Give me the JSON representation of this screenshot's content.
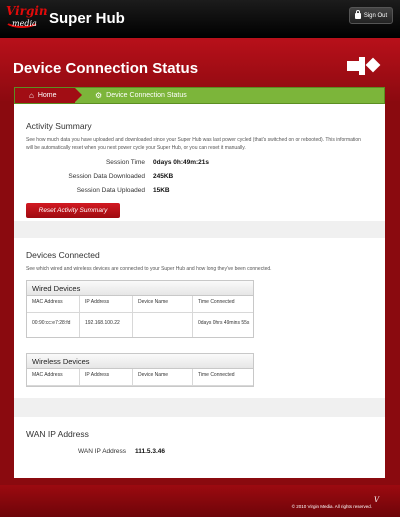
{
  "app": {
    "logo_text": "Virgin media",
    "title": "Super Hub",
    "sign_out": "Sign Out"
  },
  "page": {
    "title": "Device Connection Status"
  },
  "breadcrumb": {
    "home": "Home",
    "current": "Device Connection Status"
  },
  "activity": {
    "title": "Activity Summary",
    "description": "See how much data you have uploaded and downloaded since your Super Hub was last power cycled (that's switched on or rebooted). This information will be automatically reset when you next power cycle your Super Hub, or you can reset it manually.",
    "rows": [
      {
        "label": "Session Time",
        "value": "0days 0h:49m:21s"
      },
      {
        "label": "Session Data Downloaded",
        "value": "245KB"
      },
      {
        "label": "Session Data Uploaded",
        "value": "15KB"
      }
    ],
    "reset_button": "Reset Activity Summary"
  },
  "devices": {
    "title": "Devices Connected",
    "description": "See which wired and wireless devices are connected to your Super Hub and how long they've been connected.",
    "columns": [
      "MAC Address",
      "IP Address",
      "Device Name",
      "Time Connected"
    ],
    "wired": {
      "title": "Wired Devices",
      "rows": [
        {
          "mac": "00:90:cc:e7:28:fd",
          "ip": "192.168.100.22",
          "name": "",
          "time": "0days 0hrs 49mins 55s"
        }
      ]
    },
    "wireless": {
      "title": "Wireless Devices",
      "rows": []
    }
  },
  "wan": {
    "title": "WAN IP Address",
    "label": "WAN IP Address",
    "value": "111.5.3.46"
  },
  "footer": {
    "copyright": "© 2010 Virgin Media. All rights reserved."
  },
  "colors": {
    "brand_red": "#b8101a",
    "breadcrumb_green": "#7cb53a"
  }
}
